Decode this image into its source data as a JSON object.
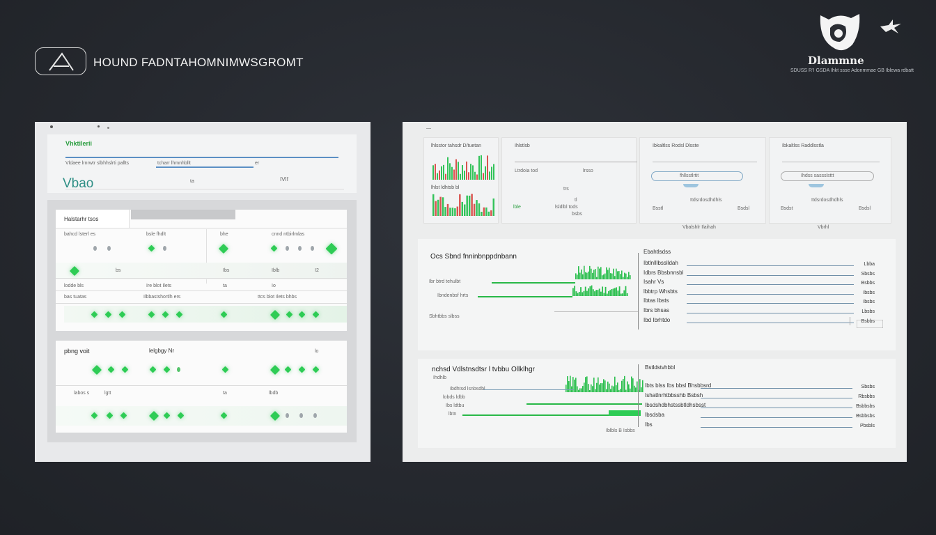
{
  "header": {
    "title": "HOUND FADNTAHOMNIMWSGROMT",
    "corner_brand": "Dlammne",
    "corner_tagline": "SDUSS R’I GSDA Ihkt ssse Adonmmae GB Iblewa rdbatt"
  },
  "left_panel": {
    "top_card": {
      "tab_label": "Vhktilerii",
      "subtext": "Vldaee lrnrwtr slbhhslrti pallts",
      "subtext2": "tcharr lhmnhbllt",
      "aside": "er",
      "big_word": "Vbao",
      "marker": "IVIf",
      "note": "ta"
    },
    "card1": {
      "tab": "Halstarhr tsos",
      "header_row": {
        "col1": "bahcd lsterl es",
        "col2": "bsle fhdlt",
        "col3": "bhe",
        "col4": "cnnd ntbirlmlas"
      },
      "values": {
        "v1": "bs",
        "v2": "Ibs",
        "v3": "Iblb",
        "v4": "I2"
      },
      "sub_row": {
        "col1": "lodde bls",
        "col2": "Ire blot Ilets",
        "col3": "ta",
        "col4": "Io"
      },
      "row3": {
        "col1": "bas tuatas",
        "col2": "Ilbbastshortlh ers",
        "col3": "ttcs blot Ilets bhbs"
      }
    },
    "card2": {
      "title": "pbng voit",
      "subtitle": "lelgbgy Nr",
      "badge": "lo",
      "row2": {
        "col1": "labos s",
        "col2": "lgtt",
        "col3": "ta",
        "col4": "lbdb"
      }
    }
  },
  "right_panel": {
    "top_marker": "—",
    "widgets": [
      {
        "caption": "lhlsstor tahsdr D/tuetan",
        "caption2": "lhlst ldhtsb bl",
        "green_label": "Lbt"
      },
      {
        "caption": "Ihlstlsb",
        "sub1": "Ltrdoia tod",
        "sub2": "lrsso",
        "sub3": "trs",
        "sub4": "tl",
        "sub5": "lsldlbl tods",
        "sub6": "bsbs",
        "green_label": "lble"
      },
      {
        "caption": "Ibkaltlss Rodsl Dlsste",
        "pill_text": "fhllsstlrtit",
        "foot1": "Bsstl",
        "foot2": "Itdsrdosdhdhls",
        "foot3": "Bsdsl",
        "under": "Vbalshlr Ilaihah"
      },
      {
        "caption": "Ibkaltlss Raddlsstla",
        "pill_text": "Ihdss sassslsttt",
        "foot1": "Bsdst",
        "foot2": "Itdsrdosdhdhls",
        "foot3": "Bsdsl",
        "under": "Vbrhl"
      }
    ],
    "section1": {
      "title": "Ocs Sbnd fnninbnppdnbann",
      "left_rows": [
        "Ibr btrd tehulbt",
        "Ibndenbsf hrts"
      ],
      "foot": "Sbhtbbs slbss",
      "list_title": "Ebahtlsdss",
      "list": [
        "Ibtlnlllbsslldah",
        "Idbrs Bbsbnnsbl",
        "Isahr Vs",
        "lbbtrp Whsbts",
        "Ibtas Ibsts",
        "Ibrs bhsas",
        "Ibd Ibrhtdo"
      ],
      "values": [
        "Lbba",
        "Sbsbs",
        "Bsbbs",
        "Ibsbs",
        "Ibsbs",
        "Lbsbs",
        "Bsbbs"
      ]
    },
    "section2": {
      "title": "nchsd Vdlstnsdtsr l tvbbu Ollklhgr",
      "sub": "Ihdhlb",
      "left_rows": [
        "Ibdhtsd lsnbsdbl",
        "lobds ldbb",
        "Ibs ldtbu",
        "lbtn"
      ],
      "foot": "Iblbls B Isbbs",
      "list_title": "Bstldstvhbbl",
      "list": [
        "Ibts blss Ibs bbsl Bhsbbsrd",
        "Ishatlnrhtbbsshb Bsbsh",
        "Ibsdshdbhstssbtldhsbsst",
        "Ibsdsba",
        "Ibs"
      ],
      "values": [
        "Sbsbs",
        "Rbsbbs",
        "Bsbbsbs",
        "Bsbbsbs",
        "Pbsbls"
      ]
    }
  },
  "colors": {
    "accent_green": "#2ecc55",
    "accent_blue": "#5b8fc4",
    "background": "#25282e"
  }
}
